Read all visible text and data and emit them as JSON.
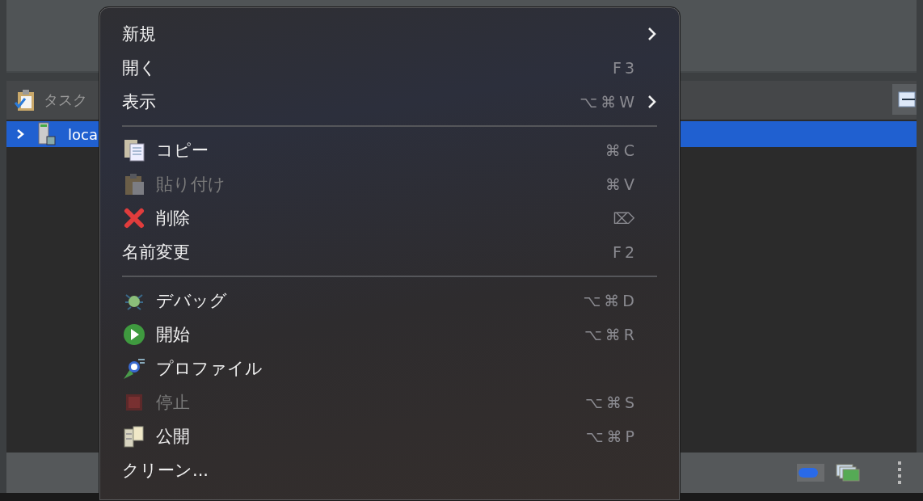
{
  "tasks_view": {
    "title": "タスク",
    "rows": [
      {
        "label": "loca",
        "selected": true,
        "expanded": false
      }
    ]
  },
  "context_menu": [
    {
      "kind": "item",
      "label": "新規",
      "submenu": true,
      "disabled": false
    },
    {
      "kind": "item",
      "label": "開く",
      "shortcut": "F3",
      "submenu": false,
      "disabled": false
    },
    {
      "kind": "item",
      "label": "表示",
      "shortcut": "⌥⌘W",
      "submenu": true,
      "disabled": false
    },
    {
      "kind": "separator"
    },
    {
      "kind": "item",
      "label": "コピー",
      "shortcut": "⌘C",
      "submenu": false,
      "disabled": false
    },
    {
      "kind": "item",
      "label": "貼り付け",
      "shortcut": "⌘V",
      "submenu": false,
      "disabled": true
    },
    {
      "kind": "item",
      "label": "削除",
      "shortcut": "⌦",
      "submenu": false,
      "disabled": false
    },
    {
      "kind": "item",
      "label": "名前変更",
      "shortcut": "F2",
      "submenu": false,
      "disabled": false
    },
    {
      "kind": "separator"
    },
    {
      "kind": "item",
      "label": "デバッグ",
      "shortcut": "⌥⌘D",
      "submenu": false,
      "disabled": false
    },
    {
      "kind": "item",
      "label": "開始",
      "shortcut": "⌥⌘R",
      "submenu": false,
      "disabled": false
    },
    {
      "kind": "item",
      "label": "プロファイル",
      "submenu": false,
      "disabled": false
    },
    {
      "kind": "item",
      "label": "停止",
      "shortcut": "⌥⌘S",
      "submenu": false,
      "disabled": true
    },
    {
      "kind": "item",
      "label": "公開",
      "shortcut": "⌥⌘P",
      "submenu": false,
      "disabled": false
    },
    {
      "kind": "item",
      "label": "クリーン...",
      "submenu": false,
      "disabled": false
    }
  ],
  "status_bar": {
    "toggle": {
      "on": true
    }
  }
}
